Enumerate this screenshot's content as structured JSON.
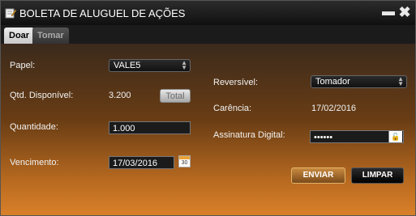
{
  "window": {
    "title": "BOLETA DE ALUGUEL DE AÇÕES",
    "minimize_label": "▬",
    "close_label": "✖"
  },
  "tabs": [
    {
      "label": "Doar",
      "active": true
    },
    {
      "label": "Tomar",
      "active": false
    }
  ],
  "left": {
    "papel_label": "Papel:",
    "papel_value": "VALE5",
    "qtd_label": "Qtd. Disponível:",
    "qtd_value": "3.200",
    "total_button": "Total",
    "quantidade_label": "Quantidade:",
    "quantidade_value": "1.000",
    "vencimento_label": "Vencimento:",
    "vencimento_value": "17/03/2016",
    "calendar_text": "30"
  },
  "right": {
    "reversivel_label": "Reversível:",
    "reversivel_value": "Tomador",
    "carencia_label": "Carência:",
    "carencia_value": "17/02/2016",
    "assinatura_label": "Assinatura Digital:",
    "assinatura_value": "••••••"
  },
  "actions": {
    "enviar": "ENVIAR",
    "limpar": "LIMPAR"
  },
  "colors": {
    "accent_orange": "#d9802a",
    "enviar_gold": "#c98a3f"
  }
}
